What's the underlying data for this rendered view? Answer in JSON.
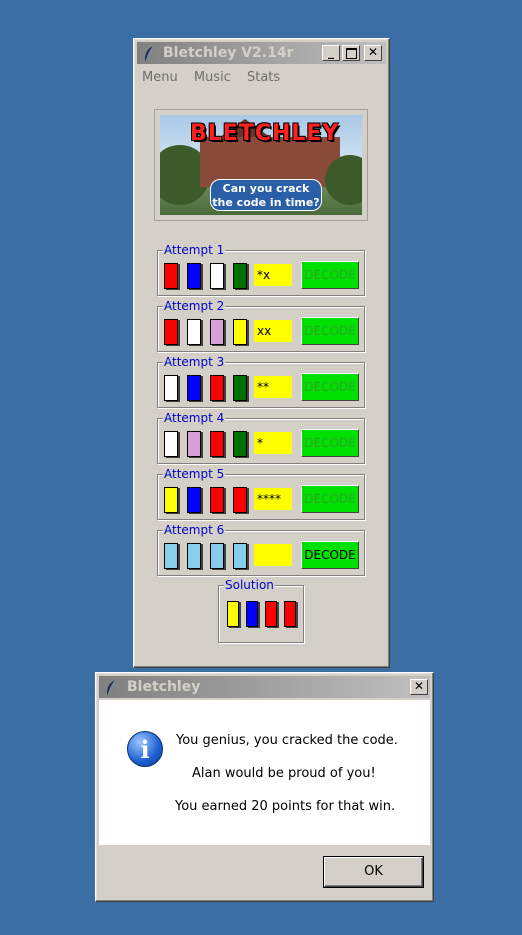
{
  "main_window": {
    "title": "Bletchley V2.14r",
    "menu": [
      "Menu",
      "Music",
      "Stats"
    ],
    "banner": {
      "logo_text": "BLETCHLEY",
      "tagline": "Can you crack the code in time?"
    },
    "attempts": [
      {
        "label": "Attempt 1",
        "pegs": [
          "#ff0000",
          "#0000ff",
          "#ffffff",
          "#007000"
        ],
        "feedback": "*x",
        "button": "DECODE",
        "active": false
      },
      {
        "label": "Attempt 2",
        "pegs": [
          "#ff0000",
          "#ffffff",
          "#d8a0d8",
          "#ffff00"
        ],
        "feedback": "xx",
        "button": "DECODE",
        "active": false
      },
      {
        "label": "Attempt 3",
        "pegs": [
          "#ffffff",
          "#0000ff",
          "#ff0000",
          "#007000"
        ],
        "feedback": "**",
        "button": "DECODE",
        "active": false
      },
      {
        "label": "Attempt 4",
        "pegs": [
          "#ffffff",
          "#d8a0d8",
          "#ff0000",
          "#007000"
        ],
        "feedback": "*",
        "button": "DECODE",
        "active": false
      },
      {
        "label": "Attempt 5",
        "pegs": [
          "#ffff00",
          "#0000ff",
          "#ff0000",
          "#ff0000"
        ],
        "feedback": "****",
        "button": "DECODE",
        "active": false
      },
      {
        "label": "Attempt 6",
        "pegs": [
          "#87ceeb",
          "#87ceeb",
          "#87ceeb",
          "#87ceeb"
        ],
        "feedback": "",
        "button": "DECODE",
        "active": true
      }
    ],
    "solution": {
      "label": "Solution",
      "pegs": [
        "#ffff00",
        "#0000ff",
        "#ff0000",
        "#ff0000"
      ]
    }
  },
  "dialog": {
    "title": "Bletchley",
    "icon": "info-icon",
    "lines": [
      "You genius, you cracked the code.",
      "Alan would be proud of you!",
      "You earned 20 points for that win."
    ],
    "ok_label": "OK"
  }
}
